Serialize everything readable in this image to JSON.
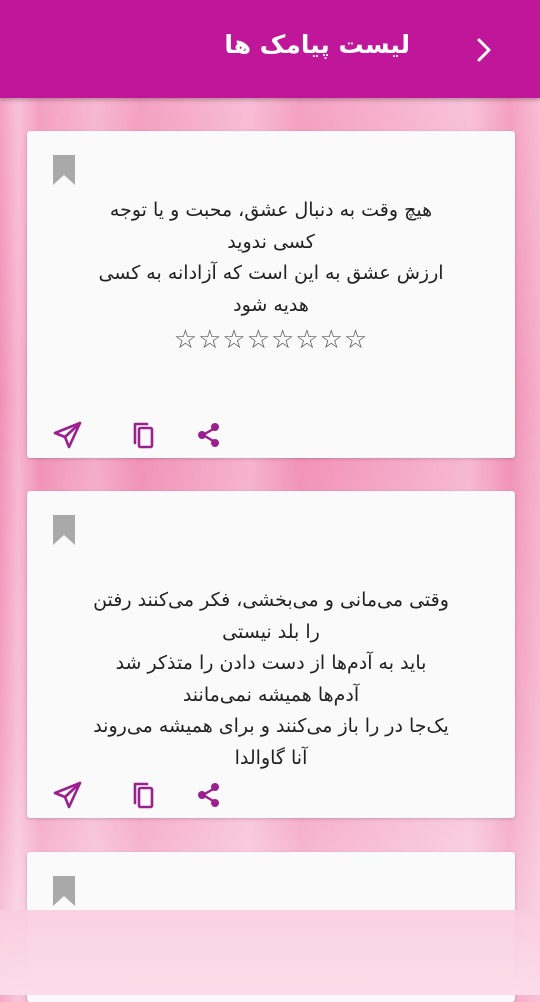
{
  "header": {
    "title": "لیست پیامک ها",
    "back_icon": "chevron-right-icon",
    "background_color": "#c0169a"
  },
  "cards": [
    {
      "bookmark_icon": "bookmark-icon",
      "lines": [
        "هیچ وقت به دنبال عشق، محبت و یا توجه",
        "کسی ندوید",
        "ارزش عشق به این است که آزادانه به کسی",
        "هدیه شود"
      ],
      "stars": "☆☆☆☆☆☆☆☆",
      "actions": [
        "send-icon",
        "copy-icon",
        "share-icon"
      ]
    },
    {
      "bookmark_icon": "bookmark-icon",
      "lines": [
        "وقتی می‌مانی و می‌بخشی، فکر می‌کنند رفتن",
        "را بلد نیستی",
        "باید به آدم‌ها از دست دادن را متذکر شد",
        "آدم‌ها همیشه نمی‌مانند",
        "یک‌جا در را باز می‌کنند و برای همیشه می‌روند",
        "آنا گاوالدا"
      ],
      "actions": [
        "send-icon",
        "copy-icon",
        "share-icon"
      ]
    },
    {
      "bookmark_icon": "bookmark-icon"
    }
  ],
  "colors": {
    "accent": "#9c1f8f",
    "bookmark": "#a9a9a9"
  }
}
